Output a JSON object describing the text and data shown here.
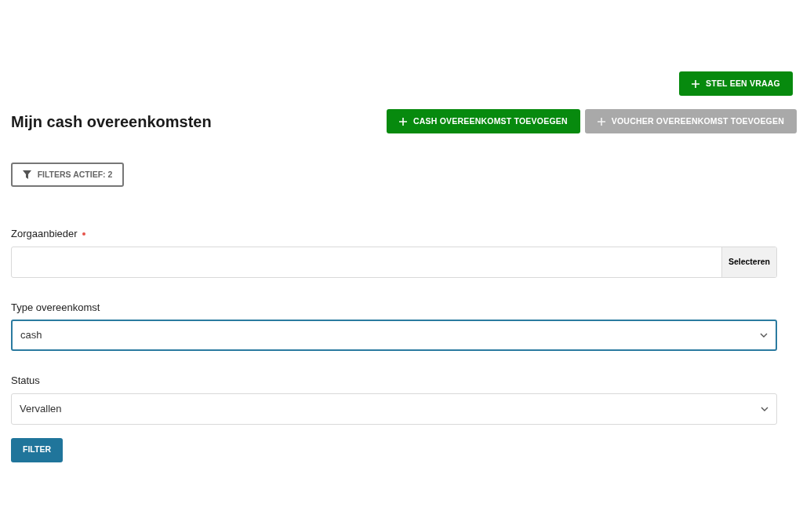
{
  "top_action": {
    "label": "STEL EEN VRAAG",
    "disabled": false
  },
  "page_title": "Mijn cash overeenkomsten",
  "header_actions": [
    {
      "label": "CASH OVEREENKOMST TOEVOEGEN",
      "disabled": false
    },
    {
      "label": "VOUCHER OVEREENKOMST TOEVOEGEN",
      "disabled": true
    }
  ],
  "filters_toggle": {
    "label": "FILTERS ACTIEF: 2"
  },
  "fields": [
    {
      "kind": "lookup",
      "label": "Zorgaanbieder",
      "required": true,
      "focused": false,
      "button": "Selecteren"
    },
    {
      "kind": "select",
      "label": "Type overeenkomst",
      "required": false,
      "focused": true,
      "value": "cash"
    },
    {
      "kind": "select",
      "label": "Status",
      "required": false,
      "focused": false,
      "value": "Vervallen"
    }
  ],
  "submit": {
    "label": "FILTER"
  }
}
